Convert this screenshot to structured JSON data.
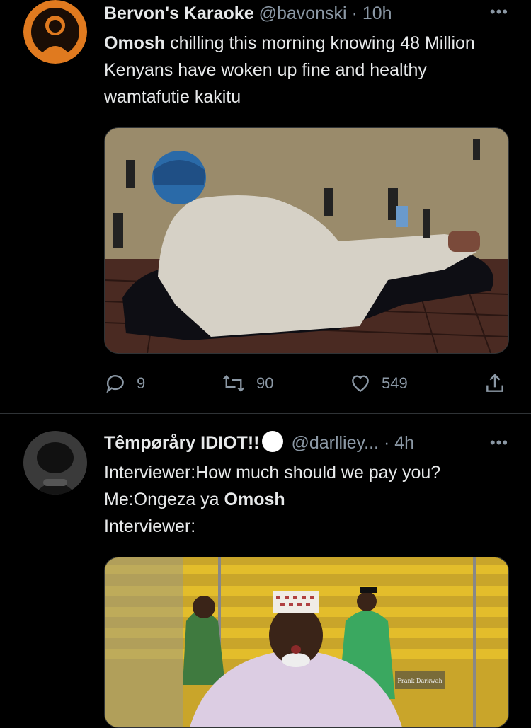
{
  "tweets": [
    {
      "author_name": "Bervon's Karaoke",
      "handle": "@bavonski",
      "time": "· 10h",
      "more": "•••",
      "text_bold": "Omosh",
      "text_rest": " chilling this morning knowing 48 Million Kenyans have woken up fine and healthy wamtafutie kakitu",
      "replies": "9",
      "retweets": "90",
      "likes": "549"
    },
    {
      "author_name": "Têmpøråry IDIOT!!",
      "handle": "@darlliey...",
      "time": "· 4h",
      "more": "•••",
      "line1": "Interviewer:How much should we pay you?",
      "line2_pre": "Me:Ongeza ya ",
      "line2_bold": "Omosh",
      "line3": "Interviewer:",
      "watermark": "Frank Darkwah"
    }
  ],
  "colors": {
    "background": "#000000",
    "text": "#e7e9ea",
    "secondary": "#8b98a5",
    "divider": "#2f3336"
  }
}
